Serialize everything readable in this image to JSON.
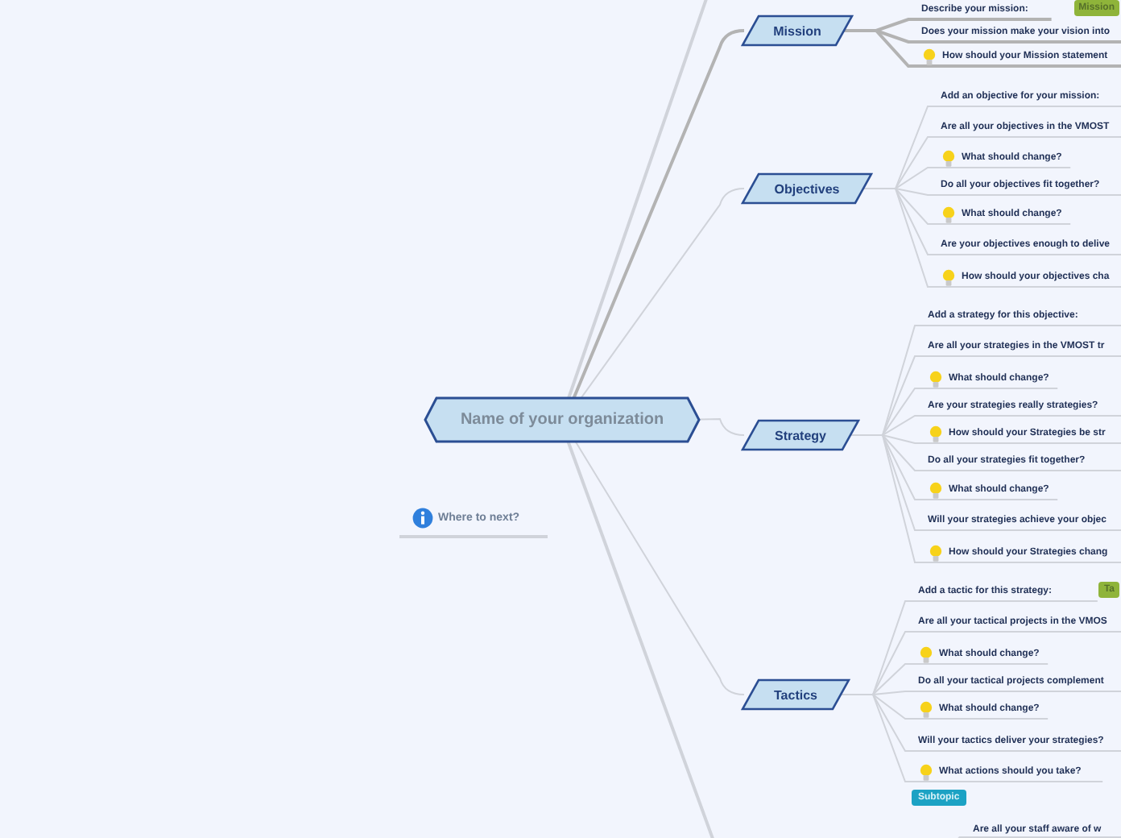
{
  "central_topic": "Name of your organization",
  "topics": [
    {
      "label": "Mission",
      "children": [
        {
          "kind": "question",
          "text": "Describe your mission:",
          "badge": "Mission"
        },
        {
          "kind": "question",
          "text": "Does your mission make your vision into"
        },
        {
          "kind": "idea",
          "text": "How should your Mission statement"
        }
      ]
    },
    {
      "label": "Objectives",
      "children": [
        {
          "kind": "question",
          "text": "Add an objective for your mission:"
        },
        {
          "kind": "question",
          "text": "Are all your objectives in the VMOST"
        },
        {
          "kind": "idea",
          "text": "What should change?"
        },
        {
          "kind": "question",
          "text": "Do all your objectives fit together?"
        },
        {
          "kind": "idea",
          "text": "What should change?"
        },
        {
          "kind": "question",
          "text": "Are your objectives enough to delive"
        },
        {
          "kind": "idea",
          "text": "How should your objectives cha"
        }
      ]
    },
    {
      "label": "Strategy",
      "children": [
        {
          "kind": "question",
          "text": "Add a strategy for this objective:"
        },
        {
          "kind": "question",
          "text": "Are all your strategies in the VMOST tr"
        },
        {
          "kind": "idea",
          "text": "What should change?"
        },
        {
          "kind": "question",
          "text": "Are your strategies really strategies?"
        },
        {
          "kind": "idea",
          "text": "How should your Strategies be str"
        },
        {
          "kind": "question",
          "text": "Do all your strategies fit together?"
        },
        {
          "kind": "idea",
          "text": "What should change?"
        },
        {
          "kind": "question",
          "text": "Will your strategies achieve your objec"
        },
        {
          "kind": "idea",
          "text": "How should your Strategies chang"
        }
      ]
    },
    {
      "label": "Tactics",
      "children": [
        {
          "kind": "question",
          "text": "Add a tactic for this strategy:",
          "badge": "Ta"
        },
        {
          "kind": "question",
          "text": "Are all your tactical projects in the VMOS"
        },
        {
          "kind": "idea",
          "text": "What should change?"
        },
        {
          "kind": "question",
          "text": "Do all your tactical projects complement"
        },
        {
          "kind": "idea",
          "text": "What should change?"
        },
        {
          "kind": "question",
          "text": "Will your tactics deliver your strategies?"
        },
        {
          "kind": "idea",
          "text": "What actions should you take?"
        },
        {
          "kind": "button",
          "text": "Subtopic"
        }
      ]
    }
  ],
  "next_step": "Where to next?",
  "fragment": "Are all your staff aware of w"
}
